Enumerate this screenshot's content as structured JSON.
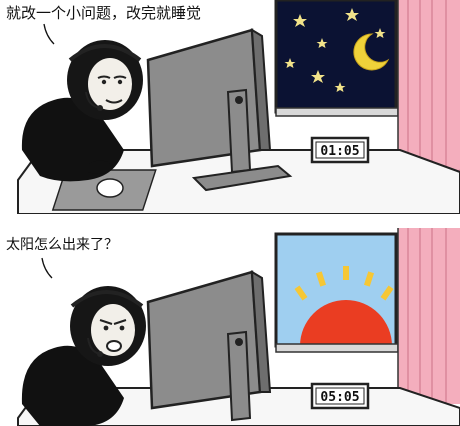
{
  "panels": [
    {
      "caption": "就改一个小问题，改完就睡觉",
      "clock_time": "01:05",
      "window_scene": "night-sky-with-moon-and-stars"
    },
    {
      "caption": "太阳怎么出来了？",
      "clock_time": "05:05",
      "window_scene": "sunrise"
    }
  ],
  "colors": {
    "night_sky": "#0b1233",
    "moon": "#f0d23a",
    "dawn_sky": "#9fcff0",
    "sun": "#ea3d22",
    "curtain": "#f4aebd",
    "monitor": "#8c8c8c"
  }
}
